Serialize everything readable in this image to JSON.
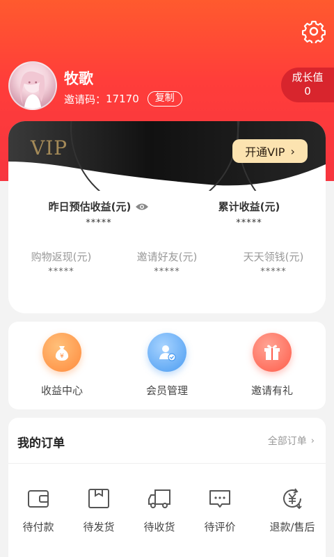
{
  "header": {
    "settings_icon": "gear-icon",
    "username": "牧歌",
    "invite_label": "邀请码：",
    "invite_code": "17170",
    "copy_label": "复制",
    "growth_label": "成长值",
    "growth_value": "0"
  },
  "vip": {
    "badge_text": "VIP",
    "open_label": "开通VIP",
    "open_chevron": "›",
    "yesterday_label": "昨日预估收益(元)",
    "yesterday_value": "*****",
    "total_label": "累计收益(元)",
    "total_value": "*****",
    "cashback_label": "购物返现(元)",
    "cashback_value": "*****",
    "invite_label": "邀请好友(元)",
    "invite_value": "*****",
    "daily_label": "天天领钱(元)",
    "daily_value": "*****"
  },
  "services": [
    {
      "label": "收益中心",
      "icon": "money-bag-icon",
      "color": "#ff9a4a"
    },
    {
      "label": "会员管理",
      "icon": "member-icon",
      "color": "#5aa8f5"
    },
    {
      "label": "邀请有礼",
      "icon": "gift-icon",
      "color": "#ff6a5a"
    }
  ],
  "orders": {
    "title": "我的订单",
    "all_label": "全部订单",
    "all_chevron": "›",
    "items": [
      {
        "label": "待付款",
        "icon": "wallet-icon"
      },
      {
        "label": "待发货",
        "icon": "box-icon"
      },
      {
        "label": "待收货",
        "icon": "truck-icon"
      },
      {
        "label": "待评价",
        "icon": "comment-icon"
      },
      {
        "label": "退款/售后",
        "icon": "refund-icon"
      }
    ]
  },
  "colors": {
    "brand_red": "#f7353f",
    "growth_bg": "#d8252d",
    "vip_gold": "#fce3b0"
  }
}
